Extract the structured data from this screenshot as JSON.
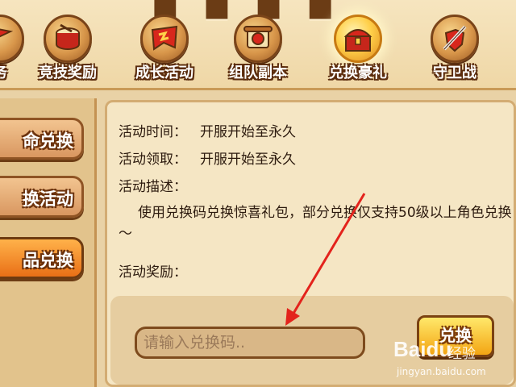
{
  "tabs": [
    {
      "label": "务",
      "icon": "flag-icon"
    },
    {
      "label": "竞技奖励",
      "icon": "drum-icon"
    },
    {
      "label": "成长活动",
      "icon": "banner-icon"
    },
    {
      "label": "组队副本",
      "icon": "scroll-icon"
    },
    {
      "label": "兑换豪礼",
      "icon": "treasure-chest-icon",
      "active": true
    },
    {
      "label": "守卫战",
      "icon": "sword-shield-icon"
    }
  ],
  "side": [
    {
      "label": "命兑换"
    },
    {
      "label": "换活动"
    },
    {
      "label": "品兑换",
      "active": true
    }
  ],
  "content": {
    "time_label": "活动时间：",
    "time_value": "开服开始至永久",
    "claim_label": "活动领取：",
    "claim_value": "开服开始至永久",
    "desc_label": "活动描述：",
    "desc_text": "使用兑换码兑换惊喜礼包，部分兑换仅支持50级以上角色兑换～",
    "reward_label": "活动奖励："
  },
  "redeem": {
    "placeholder": "请输入兑换码..",
    "button_label": "兑换"
  },
  "watermark": {
    "brand": "Baidu",
    "sub": "经验",
    "url": "jingyan.baidu.com"
  },
  "colors": {
    "accent": "#e96f16",
    "annotation_arrow": "#e3231c"
  }
}
